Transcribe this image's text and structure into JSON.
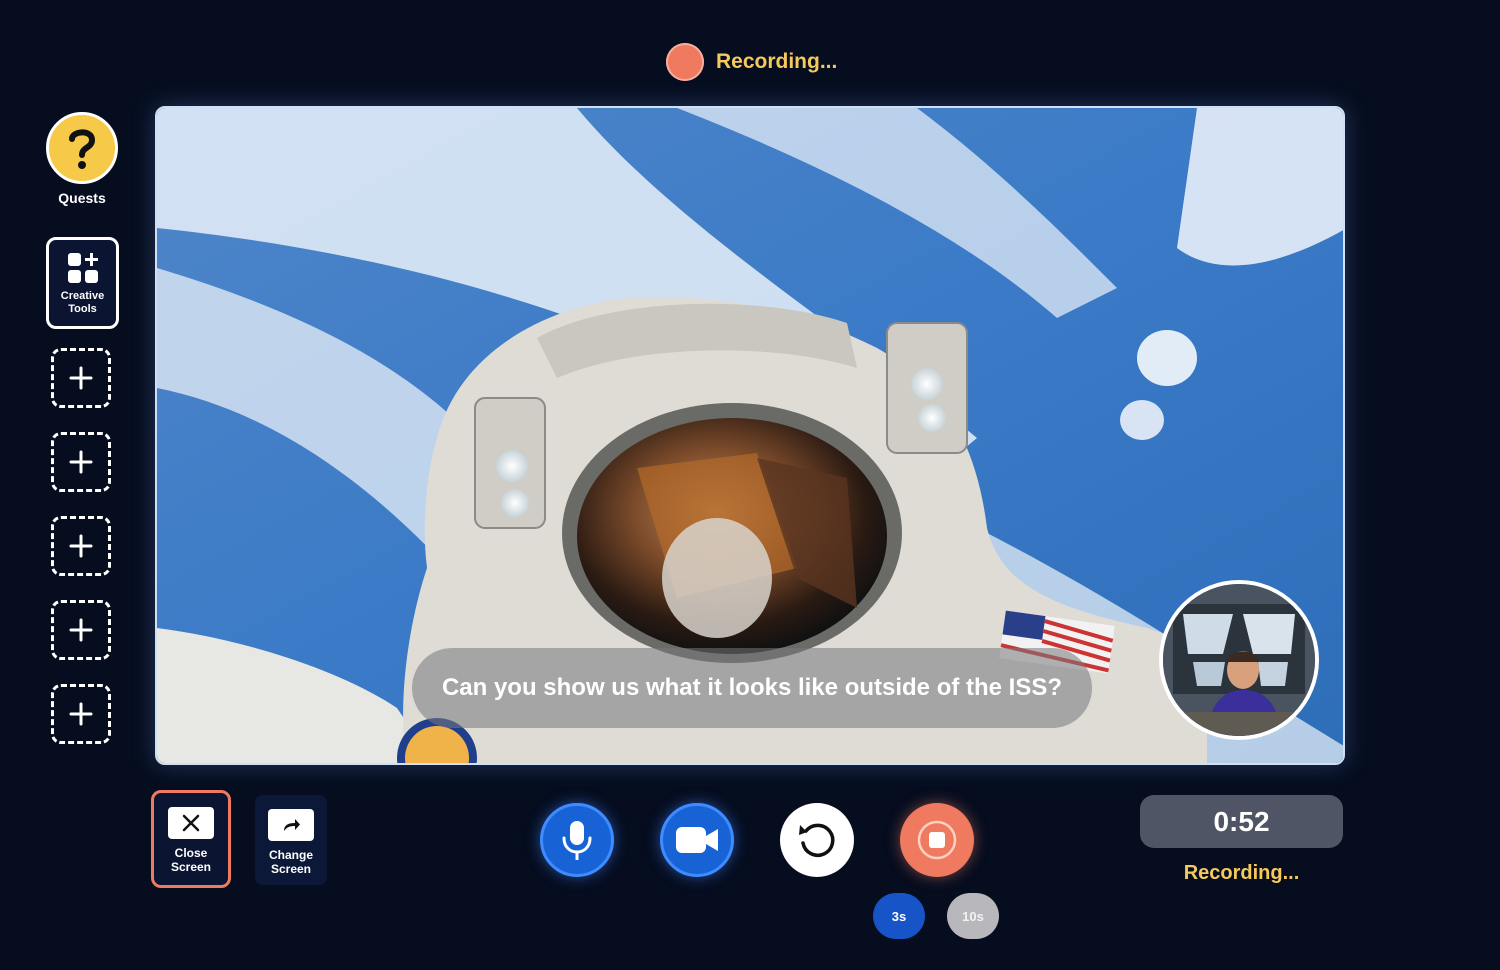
{
  "recording_indicator": {
    "label": "Recording..."
  },
  "sidebar": {
    "quests_label": "Quests",
    "creative_tools_label": "Creative\nTools",
    "empty_slots": 5
  },
  "stage": {
    "caption": "Can you show us what it looks like outside of the ISS?"
  },
  "screen_buttons": {
    "close_label": "Close\nScreen",
    "change_label": "Change\nScreen"
  },
  "controls": {
    "timer_options": [
      "3s",
      "10s"
    ],
    "selected_timer": "3s"
  },
  "timer": {
    "elapsed": "0:52",
    "status": "Recording..."
  },
  "colors": {
    "background": "#060d1f",
    "accent_blue": "#1763d6",
    "record_red": "#ef7a5f",
    "highlight_yellow": "#f5c95a"
  }
}
